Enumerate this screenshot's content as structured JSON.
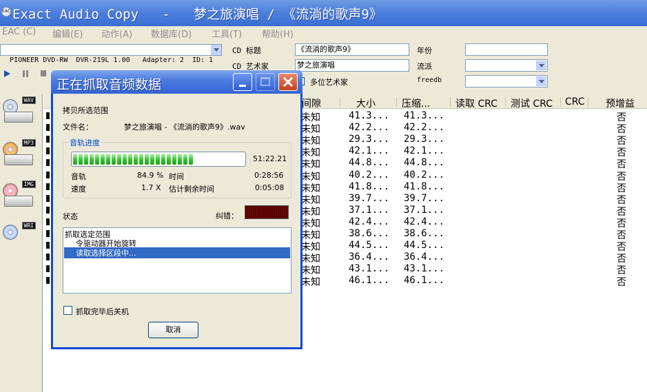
{
  "window": {
    "title": "Exact Audio Copy   -   梦之旅演唱 / 《流淌的歌声9》",
    "logo_text": "EAC"
  },
  "menu": [
    "EAC (C)",
    "编辑(E)",
    "动作(A)",
    "数据库(D)",
    "工具(T)",
    "帮助(H)"
  ],
  "drive": {
    "selected": "PIONEER DVD-RW  DVR-219L 1.00   Adapter: 2  ID: 1"
  },
  "cd_info": {
    "title_label": "CD 标题",
    "title_value": "《流淌的歌声9》",
    "artist_label": "CD 艺术家",
    "artist_value": "梦之旅演唱",
    "various_label": "多位艺术家",
    "year_label": "年份",
    "year_value": "",
    "genre_label": "流派",
    "genre_value": "",
    "freedb_label": "freedb",
    "freedb_value": ""
  },
  "sidebar": {
    "buttons": [
      {
        "tag": "WAV",
        "icon": "cd-to-wav-icon"
      },
      {
        "tag": "MP3",
        "icon": "cd-to-mp3-icon"
      },
      {
        "tag": "IMG",
        "icon": "cd-to-image-icon"
      },
      {
        "tag": "WRI",
        "icon": "write-cd-icon"
      }
    ]
  },
  "tracklist": {
    "columns": [
      "间隙",
      "大小",
      "压缩...",
      "读取 CRC",
      "测试 CRC",
      "CRC",
      "预增益"
    ],
    "rows": [
      {
        "gap": "未知",
        "size": "41.3...",
        "compressed": "41.3...",
        "preemph": "否"
      },
      {
        "gap": "未知",
        "size": "42.2...",
        "compressed": "42.2...",
        "preemph": "否"
      },
      {
        "gap": "未知",
        "size": "29.3...",
        "compressed": "29.3...",
        "preemph": "否"
      },
      {
        "gap": "未知",
        "size": "42.1...",
        "compressed": "42.1...",
        "preemph": "否"
      },
      {
        "gap": "未知",
        "size": "44.8...",
        "compressed": "44.8...",
        "preemph": "否"
      },
      {
        "gap": "未知",
        "size": "40.2...",
        "compressed": "40.2...",
        "preemph": "否"
      },
      {
        "gap": "未知",
        "size": "41.8...",
        "compressed": "41.8...",
        "preemph": "否"
      },
      {
        "gap": "未知",
        "size": "39.7...",
        "compressed": "39.7...",
        "preemph": "否"
      },
      {
        "gap": "未知",
        "size": "37.1...",
        "compressed": "37.1...",
        "preemph": "否"
      },
      {
        "gap": "未知",
        "size": "42.4...",
        "compressed": "42.4...",
        "preemph": "否"
      },
      {
        "gap": "未知",
        "size": "38.6...",
        "compressed": "38.6...",
        "preemph": "否"
      },
      {
        "gap": "未知",
        "size": "44.5...",
        "compressed": "44.5...",
        "preemph": "否"
      },
      {
        "gap": "未知",
        "size": "36.4...",
        "compressed": "36.4...",
        "preemph": "否"
      },
      {
        "gap": "未知",
        "size": "43.1...",
        "compressed": "43.1...",
        "preemph": "否"
      },
      {
        "gap": "未知",
        "size": "46.1...",
        "compressed": "46.1...",
        "preemph": "否"
      }
    ]
  },
  "dialog": {
    "title": "正在抓取音频数据",
    "copy_range": "拷贝所选范围",
    "filename_label": "文件名：",
    "filename_value": "梦之旅演唱 - 《流淌的歌声9》.wav",
    "group_title": "音轨进度",
    "progress_fraction": 0.849,
    "progress_time": "51:22.21",
    "track_label": "音轨",
    "track_value": "84.9 %",
    "time_label": "时间",
    "time_value": "0:28:56",
    "speed_label": "速度",
    "speed_value": "1.7 X",
    "remaining_label": "估计剩余时间",
    "remaining_value": "0:05:08",
    "status_label": "状态",
    "error_label": "纠错：",
    "log": [
      "抓取选定范围",
      "令驱动器开始旋转",
      "读取选择区段中..."
    ],
    "shutdown_label": "抓取完毕后关机",
    "cancel_label": "取消"
  }
}
